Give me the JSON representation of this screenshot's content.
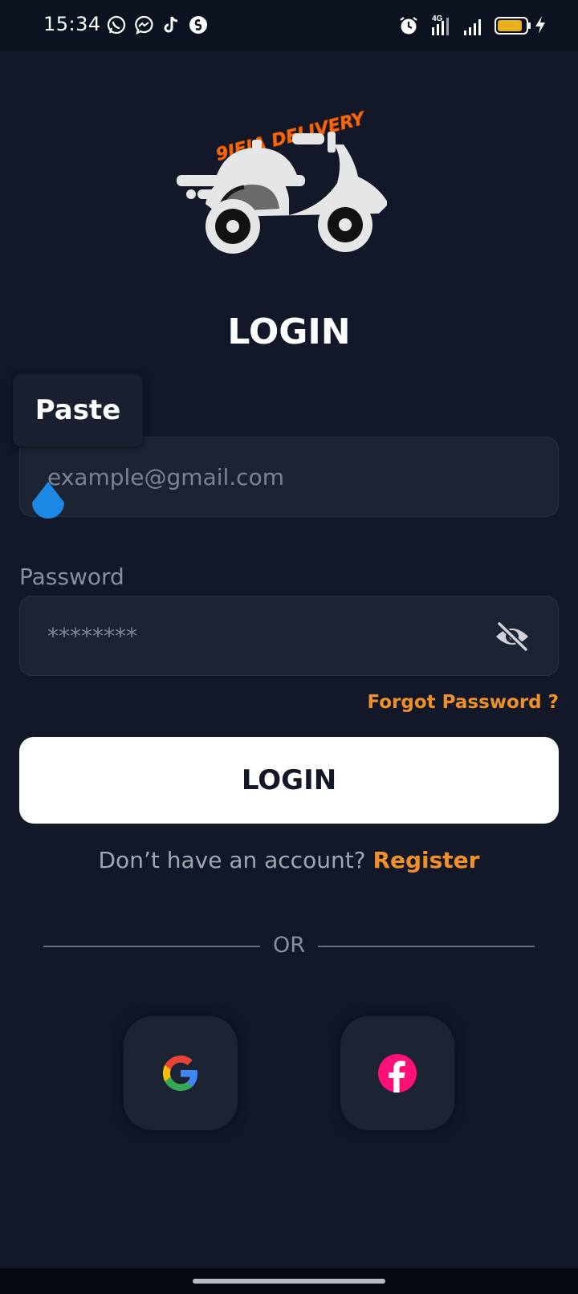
{
  "status_bar": {
    "time": "15:34",
    "left_icons": [
      "whatsapp-icon",
      "messenger-icon",
      "tiktok-icon",
      "shazam-icon"
    ],
    "right_icons": [
      "alarm-icon",
      "signal-4g-icon",
      "signal-icon",
      "battery-icon",
      "charging-icon"
    ],
    "network_label": "4G"
  },
  "logo": {
    "brand_text": "9JEJA DELIVERY",
    "accent_color": "#f06a10"
  },
  "header": {
    "title": "LOGIN"
  },
  "clipboard": {
    "paste_label": "Paste"
  },
  "form": {
    "email_placeholder": "example@gmail.com",
    "email_value": "",
    "password_label": "Password",
    "password_placeholder": "********",
    "password_value": "",
    "forgot_label": "Forgot Password ?",
    "submit_label": "LOGIN"
  },
  "register": {
    "prompt": "Don’t have an account? ",
    "link": "Register"
  },
  "divider": {
    "label": "OR"
  },
  "social": {
    "google_icon": "google-icon",
    "facebook_icon": "facebook-icon"
  },
  "colors": {
    "background": "#121828",
    "field": "#1c2434",
    "accent": "#f0902a",
    "button": "#ffffff"
  }
}
